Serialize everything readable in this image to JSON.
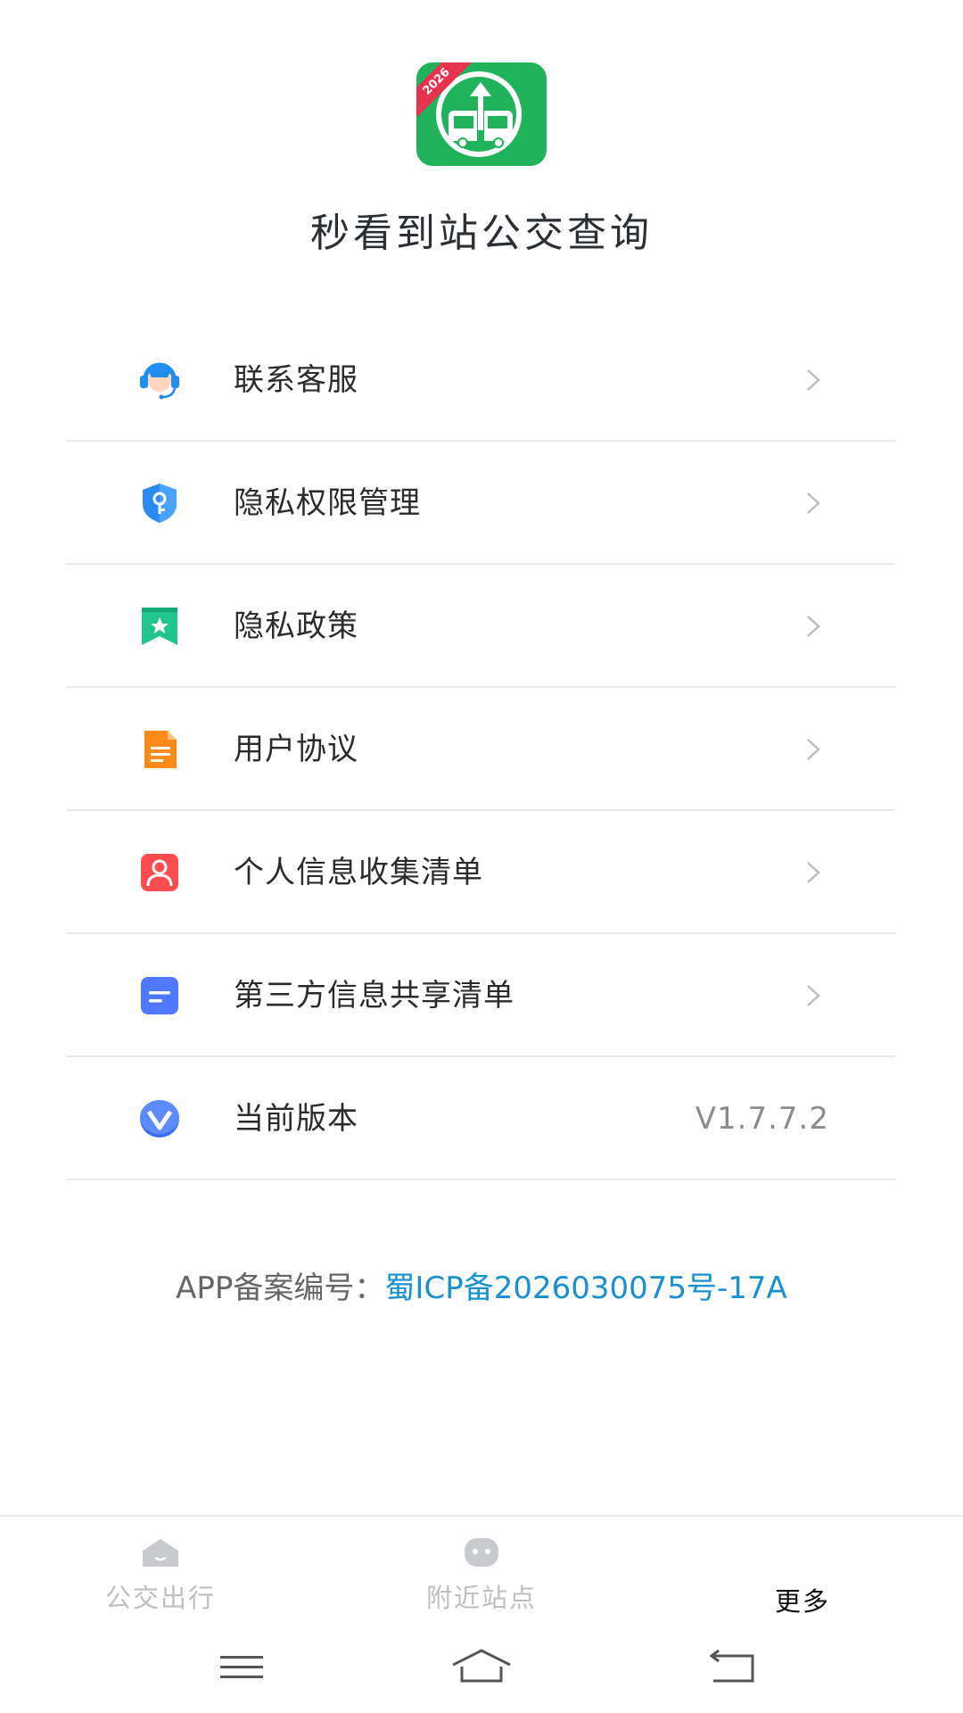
{
  "app": {
    "title": "秒看到站公交查询",
    "logo_year": "2026"
  },
  "menu": {
    "items": [
      {
        "label": "联系客服",
        "icon": "customer-service-icon"
      },
      {
        "label": "隐私权限管理",
        "icon": "shield-key-icon"
      },
      {
        "label": "隐私政策",
        "icon": "bookmark-star-icon"
      },
      {
        "label": "用户协议",
        "icon": "document-icon"
      },
      {
        "label": "个人信息收集清单",
        "icon": "person-icon"
      },
      {
        "label": "第三方信息共享清单",
        "icon": "list-doc-icon"
      },
      {
        "label": "当前版本",
        "icon": "version-icon",
        "value": "V1.7.7.2"
      }
    ]
  },
  "icp": {
    "label": "APP备案编号：",
    "value": "蜀ICP备2026030075号-17A"
  },
  "tabbar": {
    "tabs": [
      {
        "label": "公交出行",
        "active": false
      },
      {
        "label": "附近站点",
        "active": false
      },
      {
        "label": "更多",
        "active": true
      }
    ]
  },
  "colors": {
    "brand_green": "#21b35b",
    "link_blue": "#1990cf",
    "tab_inactive": "#bfbfbf",
    "tab_active": "#111111"
  }
}
